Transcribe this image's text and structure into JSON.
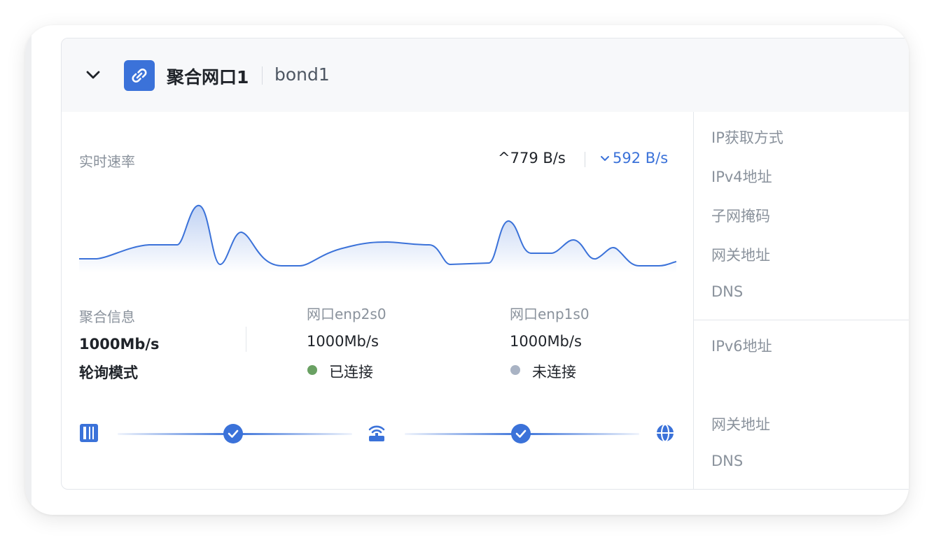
{
  "header": {
    "title": "聚合网口1",
    "subtitle": "bond1"
  },
  "speed": {
    "label": "实时速率",
    "up": "^779 B/s",
    "down": "592 B/s"
  },
  "info": {
    "bond": {
      "label": "聚合信息",
      "speed": "1000Mb/s",
      "mode": "轮询模式"
    },
    "port1": {
      "label": "网口enp2s0",
      "speed": "1000Mb/s",
      "status": "已连接",
      "status_color": "#6aa163"
    },
    "port2": {
      "label": "网口enp1s0",
      "speed": "1000Mb/s",
      "status": "未连接",
      "status_color": "#a9b3c4"
    }
  },
  "right_panel": {
    "ipv4": [
      "IP获取方式",
      "IPv4地址",
      "子网掩码",
      "网关地址",
      "DNS"
    ],
    "ipv6": [
      "IPv6地址",
      "网关地址",
      "DNS"
    ]
  },
  "topology": {
    "icons": [
      "server-icon",
      "router-icon",
      "globe-icon"
    ],
    "links": [
      "connected",
      "connected"
    ]
  },
  "colors": {
    "accent": "#3b72d9",
    "muted": "#8a929c"
  }
}
